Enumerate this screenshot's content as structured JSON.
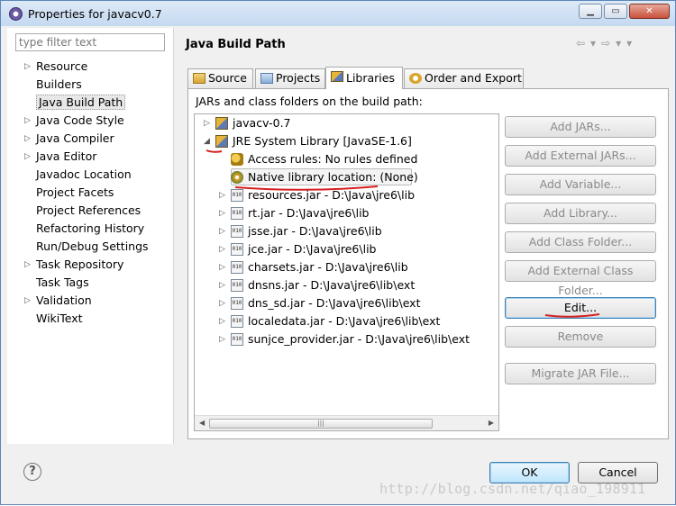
{
  "window": {
    "title": "Properties for javacv0.7"
  },
  "filter": {
    "placeholder": "type filter text"
  },
  "nav": {
    "items": [
      {
        "label": "Resource",
        "twisty": "▷"
      },
      {
        "label": "Builders",
        "twisty": ""
      },
      {
        "label": "Java Build Path",
        "twisty": "",
        "selected": true
      },
      {
        "label": "Java Code Style",
        "twisty": "▷"
      },
      {
        "label": "Java Compiler",
        "twisty": "▷"
      },
      {
        "label": "Java Editor",
        "twisty": "▷"
      },
      {
        "label": "Javadoc Location",
        "twisty": ""
      },
      {
        "label": "Project Facets",
        "twisty": ""
      },
      {
        "label": "Project References",
        "twisty": ""
      },
      {
        "label": "Refactoring History",
        "twisty": ""
      },
      {
        "label": "Run/Debug Settings",
        "twisty": ""
      },
      {
        "label": "Task Repository",
        "twisty": "▷"
      },
      {
        "label": "Task Tags",
        "twisty": ""
      },
      {
        "label": "Validation",
        "twisty": "▷"
      },
      {
        "label": "WikiText",
        "twisty": ""
      }
    ]
  },
  "page": {
    "title": "Java Build Path",
    "header_icons": "⇦▾⇨▾▾"
  },
  "tabs": [
    {
      "label": "Source",
      "active": false
    },
    {
      "label": "Projects",
      "active": false
    },
    {
      "label": "Libraries",
      "active": true
    },
    {
      "label": "Order and Export",
      "active": false
    }
  ],
  "libraries": {
    "heading": "JARs and class folders on the build path:",
    "tree": [
      {
        "text": "javacv-0.7",
        "twisty": "▷",
        "icon": "library-icon"
      },
      {
        "text": "JRE System Library [JavaSE-1.6]",
        "twisty": "◢",
        "icon": "library-icon"
      },
      {
        "text": "Access rules: No rules defined",
        "twisty": "",
        "icon": "key-icon"
      },
      {
        "text": "Native library location: (None)",
        "twisty": "",
        "icon": "gear-icon"
      },
      {
        "text": "resources.jar - D:\\Java\\jre6\\lib",
        "twisty": "▷",
        "icon": "jar-icon"
      },
      {
        "text": "rt.jar - D:\\Java\\jre6\\lib",
        "twisty": "▷",
        "icon": "jar-icon"
      },
      {
        "text": "jsse.jar - D:\\Java\\jre6\\lib",
        "twisty": "▷",
        "icon": "jar-icon"
      },
      {
        "text": "jce.jar - D:\\Java\\jre6\\lib",
        "twisty": "▷",
        "icon": "jar-icon"
      },
      {
        "text": "charsets.jar - D:\\Java\\jre6\\lib",
        "twisty": "▷",
        "icon": "jar-icon"
      },
      {
        "text": "dnsns.jar - D:\\Java\\jre6\\lib\\ext",
        "twisty": "▷",
        "icon": "jar-icon"
      },
      {
        "text": "dns_sd.jar - D:\\Java\\jre6\\lib\\ext",
        "twisty": "▷",
        "icon": "jar-icon"
      },
      {
        "text": "localedata.jar - D:\\Java\\jre6\\lib\\ext",
        "twisty": "▷",
        "icon": "jar-icon"
      },
      {
        "text": "sunjce_provider.jar - D:\\Java\\jre6\\lib\\ext",
        "twisty": "▷",
        "icon": "jar-icon"
      }
    ],
    "buttons": {
      "add_jars": "Add JARs...",
      "add_external_jars": "Add External JARs...",
      "add_variable": "Add Variable...",
      "add_library": "Add Library...",
      "add_class_folder": "Add Class Folder...",
      "add_external_class_folder": "Add External Class Folder...",
      "edit": "Edit...",
      "remove": "Remove",
      "migrate_jar": "Migrate JAR File..."
    }
  },
  "footer": {
    "help": "?",
    "ok": "OK",
    "cancel": "Cancel"
  },
  "watermark": "http://blog.csdn.net/qiao_198911",
  "colors": {
    "annotation_red": "#d41f1f",
    "selection_blue": "#3c7fb1"
  }
}
